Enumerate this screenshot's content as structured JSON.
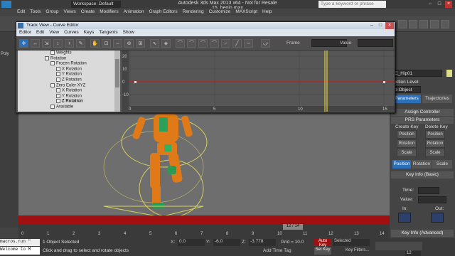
{
  "titlebar": {
    "workspace": "Workspace: Default",
    "title": "Autodesk 3ds Max  2013 x64  - Not for Resale   15_begin.max",
    "search_placeholder": "Type a keyword or phrase"
  },
  "main_menu": [
    "Edit",
    "Tools",
    "Group",
    "Views",
    "Create",
    "Modifiers",
    "Animation",
    "Graph Editors",
    "Rendering",
    "Customize",
    "MAXScript",
    "Help"
  ],
  "left_strip": [
    "Poly"
  ],
  "curve_editor": {
    "title": "Track View - Curve Editor",
    "menu": [
      "Editor",
      "Edit",
      "View",
      "Curves",
      "Keys",
      "Tangents",
      "Show"
    ],
    "frame_label": "Frame",
    "value_label": "Value",
    "tree": [
      {
        "label": "Weights",
        "indent": 1,
        "bold": false
      },
      {
        "label": "Rotation",
        "indent": 0,
        "bold": false
      },
      {
        "label": "Frozen Rotation",
        "indent": 1,
        "bold": false
      },
      {
        "label": "X Rotation",
        "indent": 2,
        "bold": false
      },
      {
        "label": "Y Rotation",
        "indent": 2,
        "bold": false
      },
      {
        "label": "Z Rotation",
        "indent": 2,
        "bold": false
      },
      {
        "label": "Zero Euler XYZ",
        "indent": 1,
        "bold": false
      },
      {
        "label": "X Rotation",
        "indent": 2,
        "bold": false
      },
      {
        "label": "Y Rotation",
        "indent": 2,
        "bold": false
      },
      {
        "label": "Z Rotation",
        "indent": 2,
        "bold": true
      },
      {
        "label": "Available",
        "indent": 1,
        "bold": false
      }
    ],
    "graph": {
      "y_labels": [
        "20",
        "10",
        "0",
        "-10"
      ],
      "x_labels": [
        "0",
        "5",
        "10",
        "15"
      ]
    }
  },
  "right_panel": {
    "object_name": "C_Hip01",
    "selection_level_label": "lection Level:",
    "selection_level_value": "b-Object",
    "tabs": [
      "Parameters",
      "Trajectories"
    ],
    "assign_controller": "Assign Controller",
    "prs_parameters": "PRS Parameters",
    "create_key": "Create Key",
    "delete_key": "Delete Key",
    "buttons": [
      "Position",
      "Rotation",
      "Scale"
    ],
    "bottom_tabs": [
      "Position",
      "Rotation",
      "Scale"
    ],
    "key_info_basic": "Key Info (Basic)",
    "time_label": "Time:",
    "value_label": "Value:",
    "in_label": "In:",
    "out_label": "Out:",
    "key_info_adv": "Key Info (Advanced)"
  },
  "timeline": {
    "frame_display": "12 / 14",
    "ticks": [
      "0",
      "1",
      "2",
      "3",
      "4",
      "5",
      "6",
      "7",
      "8",
      "9",
      "10",
      "11",
      "12",
      "13",
      "14"
    ]
  },
  "statusbar": {
    "objects_selected": "1 Object Selected",
    "prompt": "Click and drag to select and rotate objects",
    "x_label": "X:",
    "x_value": "0.0",
    "y_label": "Y:",
    "y_value": "-6.0",
    "z_label": "Z:",
    "z_value": "-3.778",
    "grid": "Grid = 10.0",
    "add_time_tag": "Add Time Tag",
    "auto_key": "Auto Key",
    "set_key": "Set Key",
    "key_mode": "Selected",
    "key_filters": "Key Filters...",
    "frame_input": "12",
    "maxscript_label": "macros.run \"",
    "welcome": "Welcome to M"
  }
}
